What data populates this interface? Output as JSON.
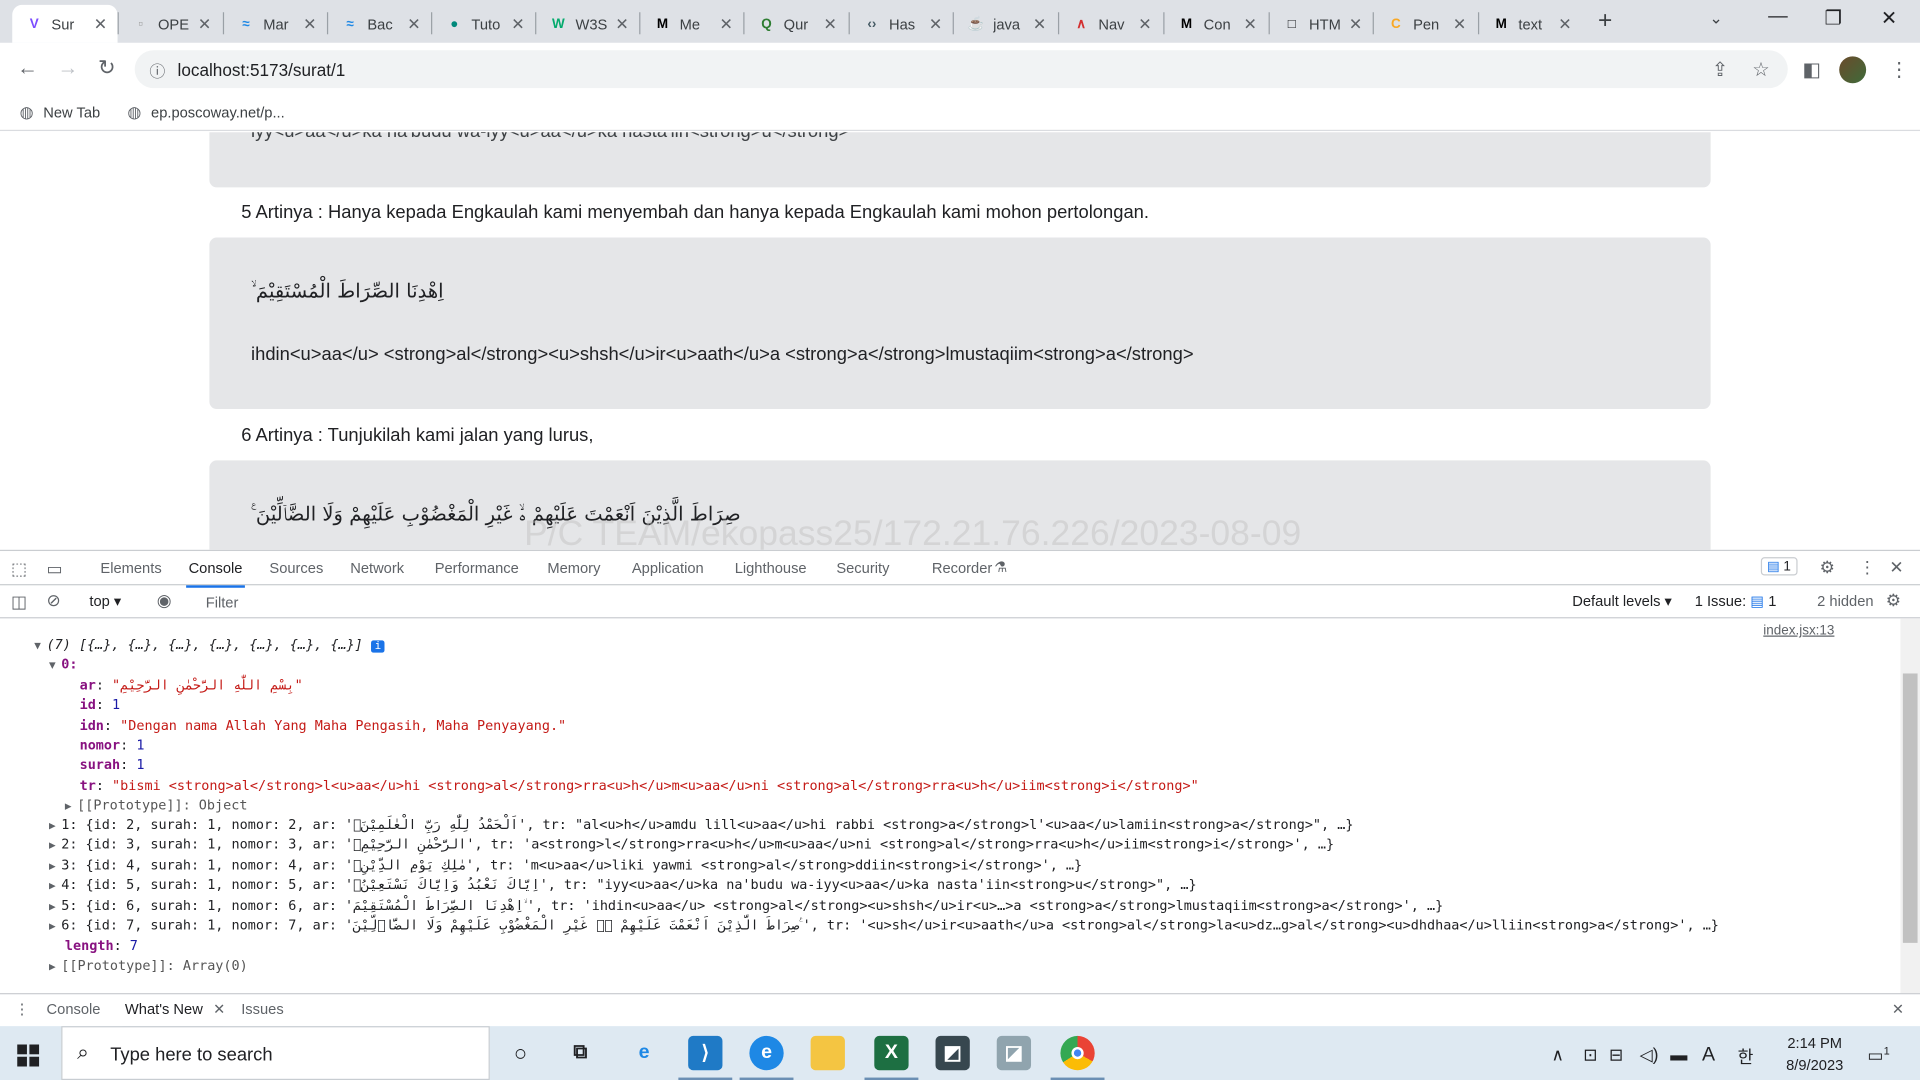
{
  "browser": {
    "tabs": [
      {
        "label": "Sur",
        "icon": "vite-icon",
        "fav_color": "#7c4dff",
        "fav_char": "V"
      },
      {
        "label": "OPE",
        "icon": "page-icon",
        "fav_color": "#9e9e9e",
        "fav_char": "▫"
      },
      {
        "label": "Mar",
        "icon": "wave-icon",
        "fav_color": "#1e88e5",
        "fav_char": "≈"
      },
      {
        "label": "Bac",
        "icon": "wave-icon",
        "fav_color": "#1e88e5",
        "fav_char": "≈"
      },
      {
        "label": "Tuto",
        "icon": "circle-logo-icon",
        "fav_color": "#00897b",
        "fav_char": "●"
      },
      {
        "label": "W3S",
        "icon": "w3schools-icon",
        "fav_color": "#04aa6d",
        "fav_char": "W"
      },
      {
        "label": "Me",
        "icon": "medium-icon",
        "fav_color": "#000000",
        "fav_char": "M"
      },
      {
        "label": "Qur",
        "icon": "quran-icon",
        "fav_color": "#2e7d32",
        "fav_char": "Q"
      },
      {
        "label": "Has",
        "icon": "code-icon",
        "fav_color": "#455a64",
        "fav_char": "‹›"
      },
      {
        "label": "java",
        "icon": "java-icon",
        "fav_color": "#e65100",
        "fav_char": "☕"
      },
      {
        "label": "Nav",
        "icon": "nav-icon",
        "fav_color": "#d32f2f",
        "fav_char": "∧"
      },
      {
        "label": "Con",
        "icon": "medium-icon",
        "fav_color": "#000000",
        "fav_char": "M"
      },
      {
        "label": "HTM",
        "icon": "square-icon",
        "fav_color": "#202124",
        "fav_char": "□"
      },
      {
        "label": "Pen",
        "icon": "codepen-icon",
        "fav_color": "#f9a825",
        "fav_char": "C"
      },
      {
        "label": "text",
        "icon": "m-icon",
        "fav_color": "#000000",
        "fav_char": "M"
      }
    ],
    "url": "localhost:5173/surat/1",
    "bookmarks": [
      {
        "label": "New Tab",
        "icon": "globe-icon"
      },
      {
        "label": "ep.poscoway.net/p...",
        "icon": "globe-icon"
      }
    ]
  },
  "page": {
    "cut_tr_line": "iyy<u>aa</u>ka na'budu wa-iyy<u>aa</u>ka nasta'iin<strong>u</strong>",
    "artinya_5": "5 Artinya : Hanya kepada Engkaulah kami menyembah dan hanya kepada Engkaulah kami mohon pertolongan.",
    "ayah6_ar": "اِهْدِنَا الصِّرَاطَ الْمُسْتَقِيْمَ ۙ",
    "ayah6_tr": "ihdin<u>aa</u> <strong>al</strong><u>shsh</u>ir<u>aath</u>a <strong>a</strong>lmustaqiim<strong>a</strong>",
    "artinya_6": "6 Artinya : Tunjukilah kami jalan yang lurus,",
    "ayah7_ar": "صِرَاطَ الَّذِيْنَ اَنْعَمْتَ عَلَيْهِمْ ەۙ غَيْرِ الْمَغْضُوْبِ عَلَيْهِمْ وَلَا الضَّاۤلِّيْنَ ࣖ",
    "watermark": "P/C TEAM/ekopass25/172.21.76.226/2023-08-09"
  },
  "devtools": {
    "tabs": [
      "Elements",
      "Console",
      "Sources",
      "Network",
      "Performance",
      "Memory",
      "Application",
      "Lighthouse",
      "Security",
      "Recorder"
    ],
    "active_tab": "Console",
    "badge_count": "1",
    "context": "top",
    "filter_placeholder": "Filter",
    "levels": "Default levels",
    "issues": "1 Issue:",
    "issues_count": "1",
    "hidden": "2 hidden",
    "source_link": "index.jsx:13",
    "summary": "(7) [{…}, {…}, {…}, {…}, {…}, {…}, {…}]",
    "obj0": {
      "index": "0:",
      "ar": "\"بِسْمِ اللّٰهِ الرَّحْمٰنِ الرَّحِيْمِ\"",
      "id": "1",
      "idn": "\"Dengan nama Allah Yang Maha Pengasih, Maha Penyayang.\"",
      "nomor": "1",
      "surah": "1",
      "tr": "\"bismi <strong>al</strong>l<u>aa</u>hi <strong>al</strong>rra<u>h</u>m<u>aa</u>ni <strong>al</strong>rra<u>h</u>iim<strong>i</strong>\"",
      "proto": "[[Prototype]]: Object"
    },
    "rows": [
      "1: {id: 2, surah: 1, nomor: 2, ar: 'اَلْحَمْدُ لِلّٰهِ رَبِّ الْعٰلَمِيْنَۙ', tr: \"al<u>h</u>amdu lill<u>aa</u>hi rabbi <strong>a</strong>l'<u>aa</u>lamiin<strong>a</strong>\", …}",
      "2: {id: 3, surah: 1, nomor: 3, ar: 'الرَّحْمٰنِ الرَّحِيْمِۙ', tr: 'a<strong>l</strong>rra<u>h</u>m<u>aa</u>ni <strong>al</strong>rra<u>h</u>iim<strong>i</strong>', …}",
      "3: {id: 4, surah: 1, nomor: 4, ar: 'مٰلِكِ يَوْمِ الدِّيْنِۗ', tr: 'm<u>aa</u>liki yawmi <strong>al</strong>ddiin<strong>i</strong>', …}",
      "4: {id: 5, surah: 1, nomor: 5, ar: 'اِيَّاكَ نَعْبُدُ وَاِيَّاكَ نَسْتَعِيْنُۗ', tr: \"iyy<u>aa</u>ka na'budu wa-iyy<u>aa</u>ka nasta'iin<strong>u</strong>\", …}",
      "5: {id: 6, surah: 1, nomor: 6, ar: 'اِهْدِنَا الصِّرَاطَ الْمُسْتَقِيْمَ ۙ', tr: 'ihdin<u>aa</u> <strong>al</strong><u>shsh</u>ir<u>…>a <strong>a</strong>lmustaqiim<strong>a</strong>', …}",
      "6: {id: 7, surah: 1, nomor: 7, ar: 'صِرَاطَ الَّذِيْنَ اَنْعَمْتَ عَلَيْهِمْ ەۙ غَيْرِ الْمَغْضُوْبِ عَلَيْهِمْ وَلَا الضَّاۤلِّيْنَ ࣖ', tr: '<u>sh</u>ir<u>aath</u>a <strong>al</strong>la<u>dz…g>al</strong><u>dhdhaa</u>lliin<strong>a</strong>', …}"
    ],
    "length": "7",
    "array_proto": "[[Prototype]]: Array(0)",
    "drawer_tabs": [
      "Console",
      "What's New",
      "Issues"
    ]
  },
  "taskbar": {
    "search_placeholder": "Type here to search",
    "time": "2:14 PM",
    "date": "8/9/2023",
    "notification_count": "1",
    "lang": "A"
  }
}
